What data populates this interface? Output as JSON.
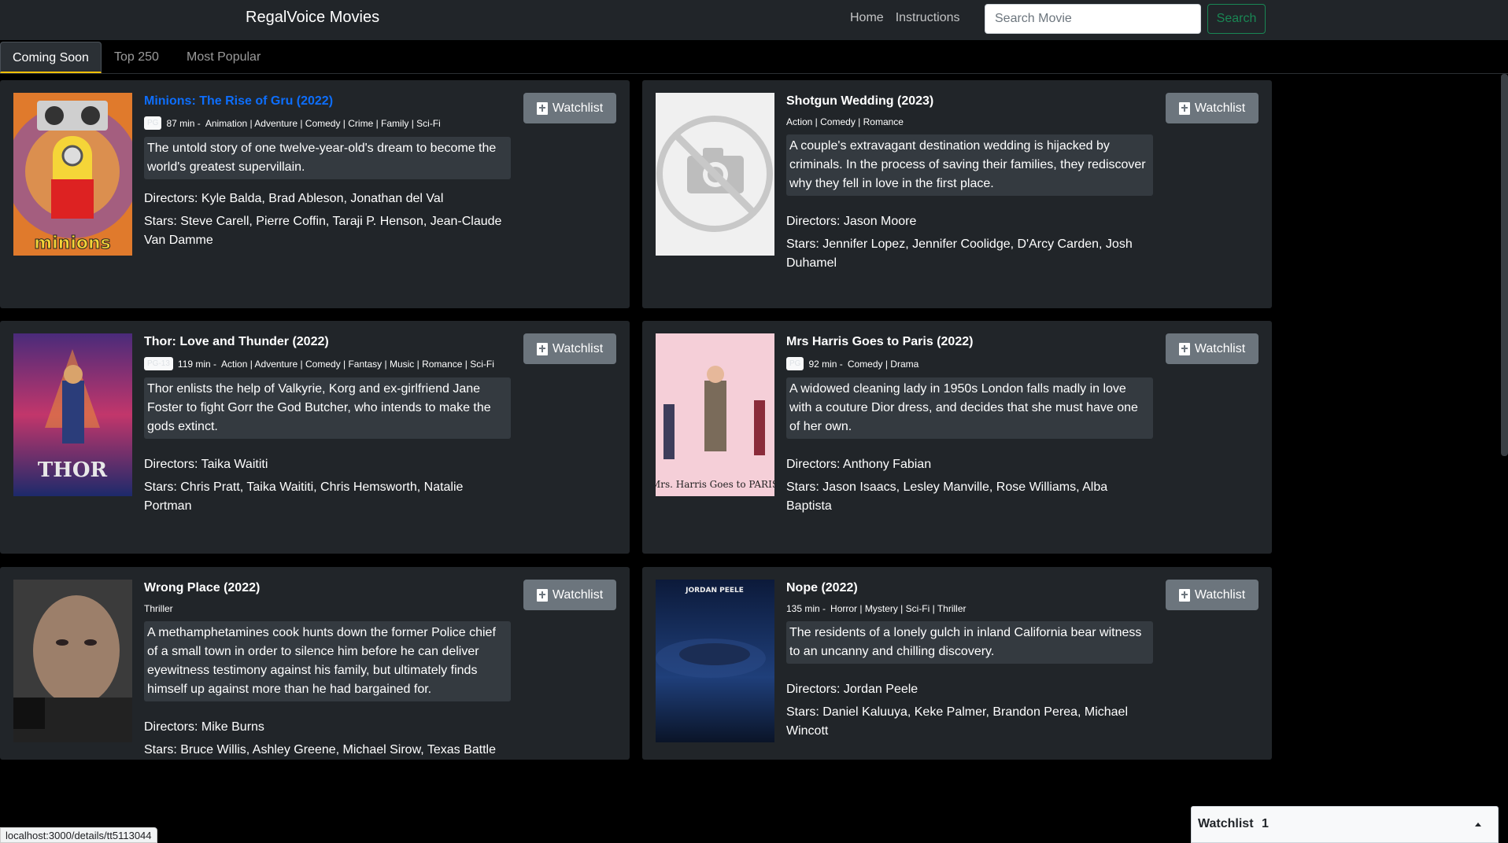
{
  "brand": "RegalVoice Movies",
  "nav": {
    "home": "Home",
    "instructions": "Instructions"
  },
  "search": {
    "placeholder": "Search Movie",
    "button": "Search"
  },
  "tabs": [
    "Coming Soon",
    "Top 250",
    "Most Popular"
  ],
  "watchlist_button": "Watchlist",
  "movies": [
    {
      "title": "Minions: The Rise of Gru (2022)",
      "rating": "PG",
      "runtime": "87 min -",
      "genres": "Animation | Adventure | Comedy | Crime | Family | Sci-Fi",
      "description": "The untold story of one twelve-year-old's dream to become the world's greatest supervillain.",
      "directors": "Directors: Kyle Balda, Brad Ableson, Jonathan del Val",
      "stars": "Stars: Steve Carell, Pierre Coffin, Taraji P. Henson, Jean-Claude Van Damme",
      "poster_text": "minions"
    },
    {
      "title": "Shotgun Wedding (2023)",
      "rating": "",
      "runtime": "",
      "genres": "Action | Comedy | Romance",
      "description": "A couple's extravagant destination wedding is hijacked by criminals. In the process of saving their families, they rediscover why they fell in love in the first place.",
      "directors": "Directors: Jason Moore",
      "stars": "Stars: Jennifer Lopez, Jennifer Coolidge, D'Arcy Carden, Josh Duhamel",
      "poster_text": ""
    },
    {
      "title": "Thor: Love and Thunder (2022)",
      "rating": "PG-13",
      "runtime": "119 min -",
      "genres": "Action | Adventure | Comedy | Fantasy | Music | Romance | Sci-Fi",
      "description": "Thor enlists the help of Valkyrie, Korg and ex-girlfriend Jane Foster to fight Gorr the God Butcher, who intends to make the gods extinct.",
      "directors": "Directors: Taika Waititi",
      "stars": "Stars: Chris Pratt, Taika Waititi, Chris Hemsworth, Natalie Portman",
      "poster_text": "THOR"
    },
    {
      "title": "Mrs Harris Goes to Paris (2022)",
      "rating": "PG",
      "runtime": "92 min -",
      "genres": "Comedy | Drama",
      "description": "A widowed cleaning lady in 1950s London falls madly in love with a couture Dior dress, and decides that she must have one of her own.",
      "directors": "Directors: Anthony Fabian",
      "stars": "Stars: Jason Isaacs, Lesley Manville, Rose Williams, Alba Baptista",
      "poster_text": "Mrs. Harris Goes to PARIS"
    },
    {
      "title": "Wrong Place (2022)",
      "rating": "",
      "runtime": "",
      "genres": "Thriller",
      "description": "A methamphetamines cook hunts down the former Police chief of a small town in order to silence him before he can deliver eyewitness testimony against his family, but ultimately finds himself up against more than he had bargained for.",
      "directors": "Directors: Mike Burns",
      "stars": "Stars: Bruce Willis, Ashley Greene, Michael Sirow, Texas Battle",
      "poster_text": ""
    },
    {
      "title": "Nope (2022)",
      "rating": "",
      "runtime": "135 min -",
      "genres": "Horror | Mystery | Sci-Fi | Thriller",
      "description": "The residents of a lonely gulch in inland California bear witness to an uncanny and chilling discovery.",
      "directors": "Directors: Jordan Peele",
      "stars": "Stars: Daniel Kaluuya, Keke Palmer, Brandon Perea, Michael Wincott",
      "poster_text": "JORDAN PEELE"
    }
  ],
  "status_url": "localhost:3000/details/tt5113044",
  "watchlist_panel": {
    "label": "Watchlist",
    "count": "1"
  },
  "colors": {
    "navbar": "#212529",
    "card": "#212529",
    "accent_link": "#0d6efd",
    "search_green": "#198754",
    "tab_underline": "#ffc107"
  }
}
